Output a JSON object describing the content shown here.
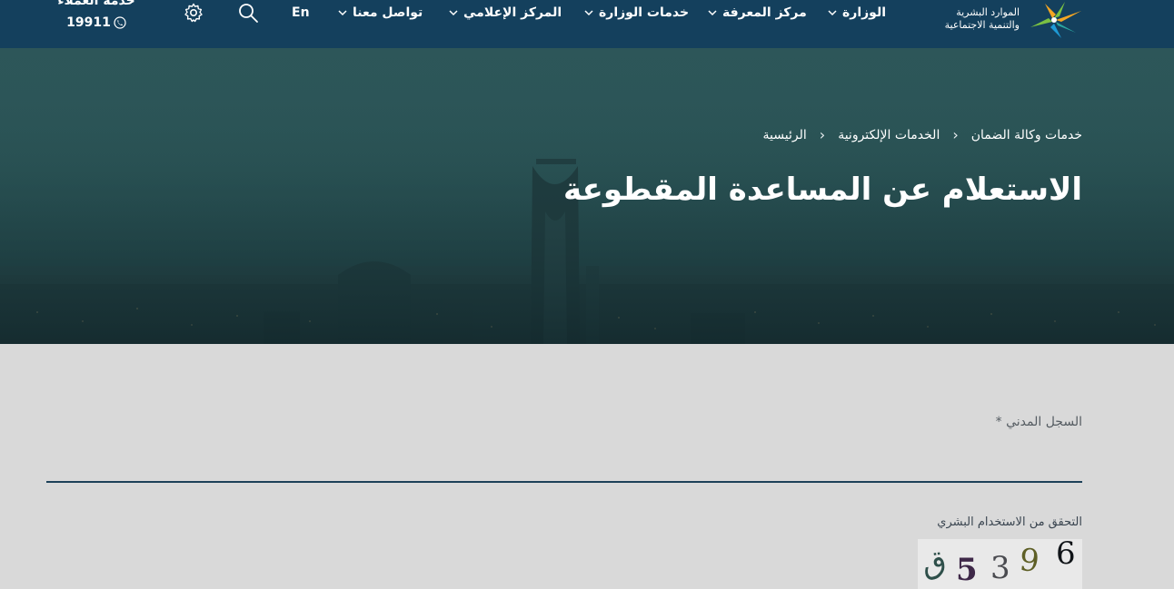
{
  "header": {
    "logo_line1": "الموارد البشرية",
    "logo_line2": "والتنمية الاجتماعية",
    "menu": [
      {
        "label": "الوزارة"
      },
      {
        "label": "مركز المعرفة"
      },
      {
        "label": "خدمات الوزارة"
      },
      {
        "label": "المركز الإعلامي"
      },
      {
        "label": "تواصل معنا"
      }
    ],
    "language_label": "En",
    "support_title": "خدمة العملاء",
    "support_number": "19911"
  },
  "breadcrumb": [
    "الرئيسية",
    "الخدمات الإلكترونية",
    "خدمات وكالة الضمان"
  ],
  "page_title": "الاستعلام عن المساعدة المقطوعة",
  "form": {
    "civil_id_label": "السجل المدني *",
    "civil_id_value": "",
    "captcha_label": "التحقق من الاستخدام البشري",
    "captcha_chars": [
      "ق",
      "5",
      "3",
      "9",
      "6"
    ]
  },
  "colors": {
    "navbar": "#14405d",
    "accent": "#1d4159",
    "page_bg": "#d9d9d9"
  },
  "icons": {
    "search": "search-icon",
    "settings": "gear-icon",
    "phone": "phone-icon",
    "chevron": "chevron-down-icon"
  }
}
